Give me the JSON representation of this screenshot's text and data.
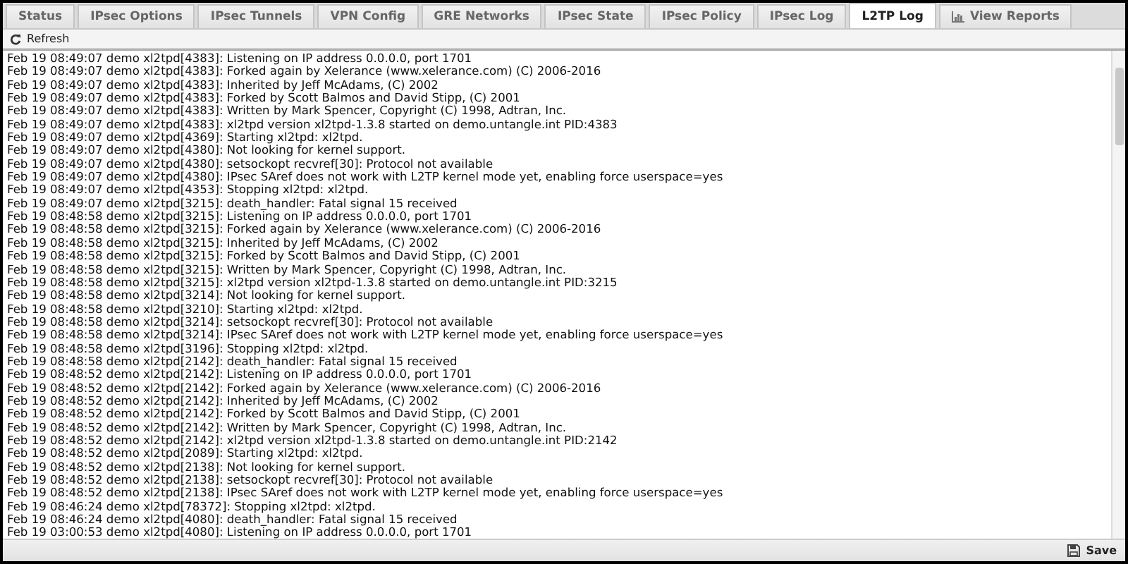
{
  "tabs": [
    {
      "label": "Status",
      "selected": false
    },
    {
      "label": "IPsec Options",
      "selected": false
    },
    {
      "label": "IPsec Tunnels",
      "selected": false
    },
    {
      "label": "VPN Config",
      "selected": false
    },
    {
      "label": "GRE Networks",
      "selected": false
    },
    {
      "label": "IPsec State",
      "selected": false
    },
    {
      "label": "IPsec Policy",
      "selected": false
    },
    {
      "label": "IPsec Log",
      "selected": false
    },
    {
      "label": "L2TP Log",
      "selected": true
    },
    {
      "label": "View Reports",
      "selected": false,
      "kind": "reports"
    }
  ],
  "toolbar": {
    "refresh": "Refresh"
  },
  "log_lines": [
    "Feb 19 08:49:07 demo xl2tpd[4383]: Listening on IP address 0.0.0.0, port 1701",
    "Feb 19 08:49:07 demo xl2tpd[4383]: Forked again by Xelerance (www.xelerance.com) (C) 2006-2016",
    "Feb 19 08:49:07 demo xl2tpd[4383]: Inherited by Jeff McAdams, (C) 2002",
    "Feb 19 08:49:07 demo xl2tpd[4383]: Forked by Scott Balmos and David Stipp, (C) 2001",
    "Feb 19 08:49:07 demo xl2tpd[4383]: Written by Mark Spencer, Copyright (C) 1998, Adtran, Inc.",
    "Feb 19 08:49:07 demo xl2tpd[4383]: xl2tpd version xl2tpd-1.3.8 started on demo.untangle.int PID:4383",
    "Feb 19 08:49:07 demo xl2tpd[4369]: Starting xl2tpd: xl2tpd.",
    "Feb 19 08:49:07 demo xl2tpd[4380]: Not looking for kernel support.",
    "Feb 19 08:49:07 demo xl2tpd[4380]: setsockopt recvref[30]: Protocol not available",
    "Feb 19 08:49:07 demo xl2tpd[4380]: IPsec SAref does not work with L2TP kernel mode yet, enabling force userspace=yes",
    "Feb 19 08:49:07 demo xl2tpd[4353]: Stopping xl2tpd: xl2tpd.",
    "Feb 19 08:49:07 demo xl2tpd[3215]: death_handler: Fatal signal 15 received",
    "Feb 19 08:48:58 demo xl2tpd[3215]: Listening on IP address 0.0.0.0, port 1701",
    "Feb 19 08:48:58 demo xl2tpd[3215]: Forked again by Xelerance (www.xelerance.com) (C) 2006-2016",
    "Feb 19 08:48:58 demo xl2tpd[3215]: Inherited by Jeff McAdams, (C) 2002",
    "Feb 19 08:48:58 demo xl2tpd[3215]: Forked by Scott Balmos and David Stipp, (C) 2001",
    "Feb 19 08:48:58 demo xl2tpd[3215]: Written by Mark Spencer, Copyright (C) 1998, Adtran, Inc.",
    "Feb 19 08:48:58 demo xl2tpd[3215]: xl2tpd version xl2tpd-1.3.8 started on demo.untangle.int PID:3215",
    "Feb 19 08:48:58 demo xl2tpd[3214]: Not looking for kernel support.",
    "Feb 19 08:48:58 demo xl2tpd[3210]: Starting xl2tpd: xl2tpd.",
    "Feb 19 08:48:58 demo xl2tpd[3214]: setsockopt recvref[30]: Protocol not available",
    "Feb 19 08:48:58 demo xl2tpd[3214]: IPsec SAref does not work with L2TP kernel mode yet, enabling force userspace=yes",
    "Feb 19 08:48:58 demo xl2tpd[3196]: Stopping xl2tpd: xl2tpd.",
    "Feb 19 08:48:58 demo xl2tpd[2142]: death_handler: Fatal signal 15 received",
    "Feb 19 08:48:52 demo xl2tpd[2142]: Listening on IP address 0.0.0.0, port 1701",
    "Feb 19 08:48:52 demo xl2tpd[2142]: Forked again by Xelerance (www.xelerance.com) (C) 2006-2016",
    "Feb 19 08:48:52 demo xl2tpd[2142]: Inherited by Jeff McAdams, (C) 2002",
    "Feb 19 08:48:52 demo xl2tpd[2142]: Forked by Scott Balmos and David Stipp, (C) 2001",
    "Feb 19 08:48:52 demo xl2tpd[2142]: Written by Mark Spencer, Copyright (C) 1998, Adtran, Inc.",
    "Feb 19 08:48:52 demo xl2tpd[2142]: xl2tpd version xl2tpd-1.3.8 started on demo.untangle.int PID:2142",
    "Feb 19 08:48:52 demo xl2tpd[2089]: Starting xl2tpd: xl2tpd.",
    "Feb 19 08:48:52 demo xl2tpd[2138]: Not looking for kernel support.",
    "Feb 19 08:48:52 demo xl2tpd[2138]: setsockopt recvref[30]: Protocol not available",
    "Feb 19 08:48:52 demo xl2tpd[2138]: IPsec SAref does not work with L2TP kernel mode yet, enabling force userspace=yes",
    "Feb 19 08:46:24 demo xl2tpd[78372]: Stopping xl2tpd: xl2tpd.",
    "Feb 19 08:46:24 demo xl2tpd[4080]: death_handler: Fatal signal 15 received",
    "Feb 19 03:00:53 demo xl2tpd[4080]: Listening on IP address 0.0.0.0, port 1701"
  ],
  "footer": {
    "save": "Save"
  }
}
